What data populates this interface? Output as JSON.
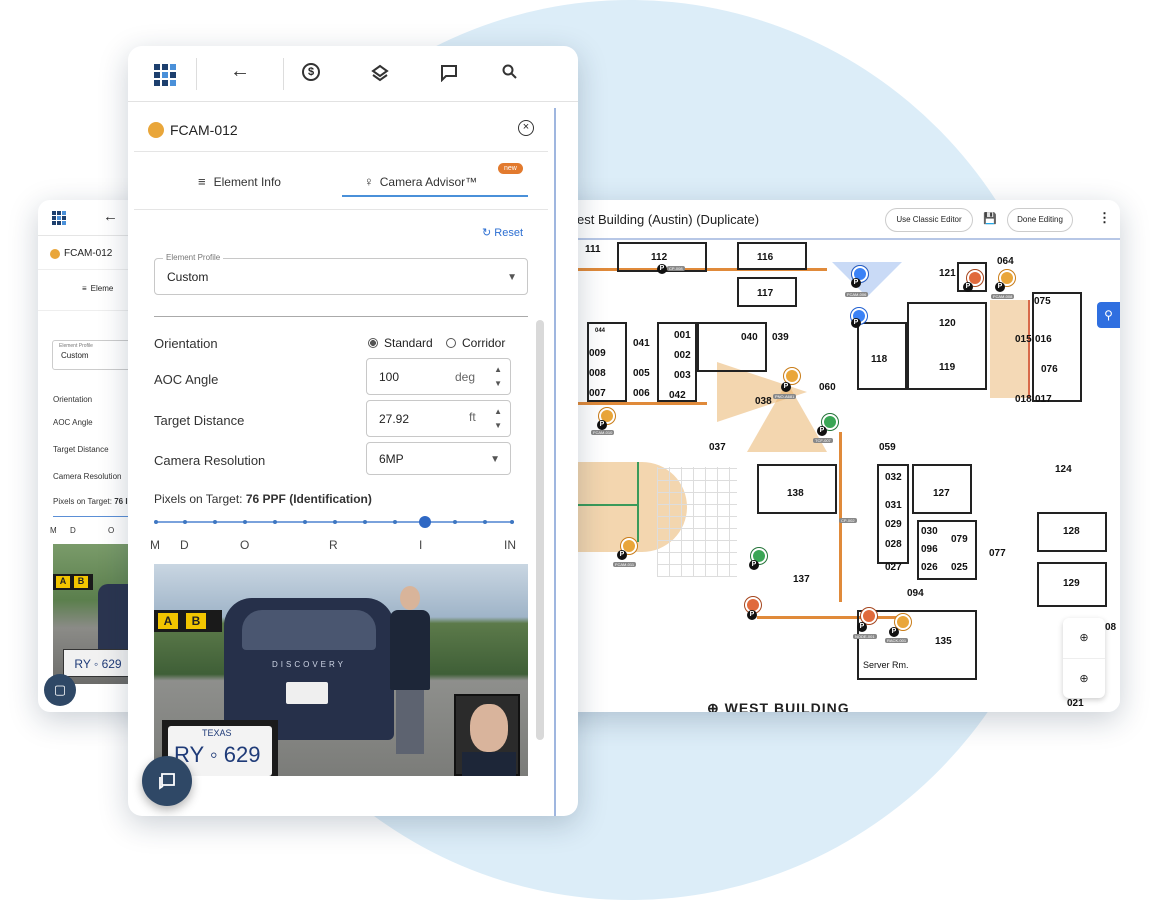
{
  "front": {
    "element_name": "FCAM-012",
    "tabs": [
      {
        "label": "Element Info"
      },
      {
        "label": "Camera Advisor™",
        "badge": "new"
      }
    ],
    "reset_label": "Reset",
    "element_profile": {
      "label": "Element Profile",
      "value": "Custom"
    },
    "orientation": {
      "label": "Orientation",
      "options": [
        "Standard",
        "Corridor"
      ],
      "selected": "Standard"
    },
    "aoc_angle": {
      "label": "AOC Angle",
      "value": "100",
      "unit": "deg"
    },
    "target_distance": {
      "label": "Target Distance",
      "value": "27.92",
      "unit": "ft"
    },
    "camera_resolution": {
      "label": "Camera Resolution",
      "value": "6MP"
    },
    "pixels_on_target": {
      "label": "Pixels on Target:",
      "value": "76 PPF (Identification)"
    },
    "ppf_scale": {
      "labels": [
        "M",
        "D",
        "O",
        "R",
        "I",
        "IN"
      ],
      "level": 0.75
    },
    "photo": {
      "plate_state": "TEXAS",
      "plate_number": "RY ◦ 629",
      "car_badge": "DISCOVERY",
      "sign_letters": [
        "A",
        "B"
      ]
    }
  },
  "back": {
    "element_name": "FCAM-012",
    "tab_label": "Eleme",
    "profile_label": "Element Profile",
    "profile_value": "Custom",
    "rows": [
      "Orientation",
      "AOC Angle",
      "Target Distance",
      "Camera Resolution"
    ],
    "pixels_label": "Pixels on Target:",
    "pixels_value": "76 I",
    "scale_labels": [
      "M",
      "D",
      "O"
    ],
    "plate": "RY ◦ 629",
    "sign_letters": [
      "A",
      "B"
    ]
  },
  "map": {
    "title": "est Building (Austin) (Duplicate)",
    "classic_editor_label": "Use Classic Editor",
    "done_editing_label": "Done Editing",
    "building_label": "WEST BUILDING",
    "rooms": [
      "111",
      "112",
      "116",
      "117",
      "121",
      "064",
      "075",
      "120",
      "040",
      "039",
      "041",
      "001",
      "002",
      "003",
      "009",
      "008",
      "005",
      "006",
      "007",
      "042",
      "044",
      "118",
      "119",
      "015",
      "016",
      "076",
      "060",
      "018",
      "017",
      "037",
      "059",
      "038",
      "124",
      "138",
      "032",
      "031",
      "127",
      "029",
      "028",
      "030",
      "079",
      "096",
      "027",
      "026",
      "025",
      "077",
      "128",
      "137",
      "094",
      "129",
      "135",
      "Server Rm.",
      "08",
      "021"
    ],
    "camera_tags": [
      "CP-008",
      "FCAM-006",
      "FCAM-008",
      "PNO-A681",
      "FCAM-010",
      "TCF-007",
      "CP-002",
      "FCAM-011",
      "NODE-001",
      "RACK-001"
    ]
  },
  "icons": {
    "logo": "grid-logo-icon",
    "back": "arrow-left-icon",
    "dollar": "dollar-circle-icon",
    "layers": "layers-icon",
    "chat": "chat-icon",
    "search": "search-icon"
  }
}
